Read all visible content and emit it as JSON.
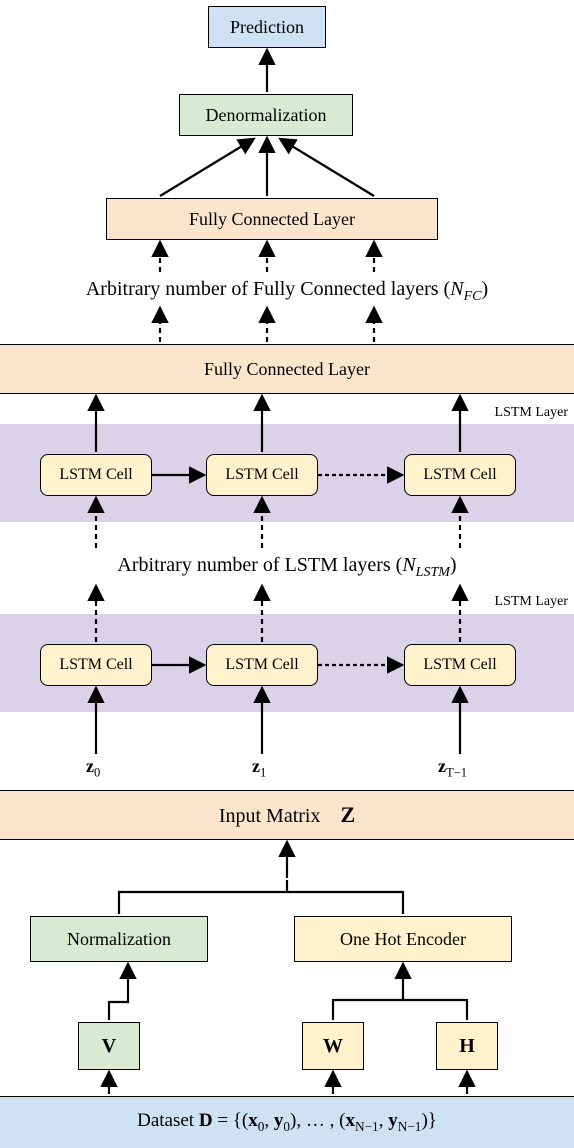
{
  "prediction": "Prediction",
  "denormalization": "Denormalization",
  "fc_layer": "Fully Connected Layer",
  "fc_annot_left": "Arbitrary number of Fully Connected layers (",
  "fc_annot_sym": "N",
  "fc_annot_sub": "FC",
  "fc_annot_right": ")",
  "lstm_layer_label": "LSTM Layer",
  "lstm_cell": "LSTM Cell",
  "lstm_annot_left": "Arbitrary number of LSTM layers (",
  "lstm_annot_sym": "N",
  "lstm_annot_sub": "LSTM",
  "lstm_annot_right": ")",
  "z0": "z",
  "z0_sub": "0",
  "z1": "z",
  "z1_sub": "1",
  "zT": "z",
  "zT_sub": "T−1",
  "input_matrix_left": "Input Matrix",
  "input_matrix_sym": "Z",
  "normalization": "Normalization",
  "one_hot": "One Hot Encoder",
  "V": "V",
  "W": "W",
  "H": "H",
  "dataset_left": "Dataset ",
  "dataset_D": "D",
  "dataset_eq": " = {(",
  "dataset_x": "x",
  "dataset_0": "0",
  "dataset_y": "y",
  "dataset_mid": "), … , (",
  "dataset_Nm1": "N−1",
  "dataset_end": ")}"
}
